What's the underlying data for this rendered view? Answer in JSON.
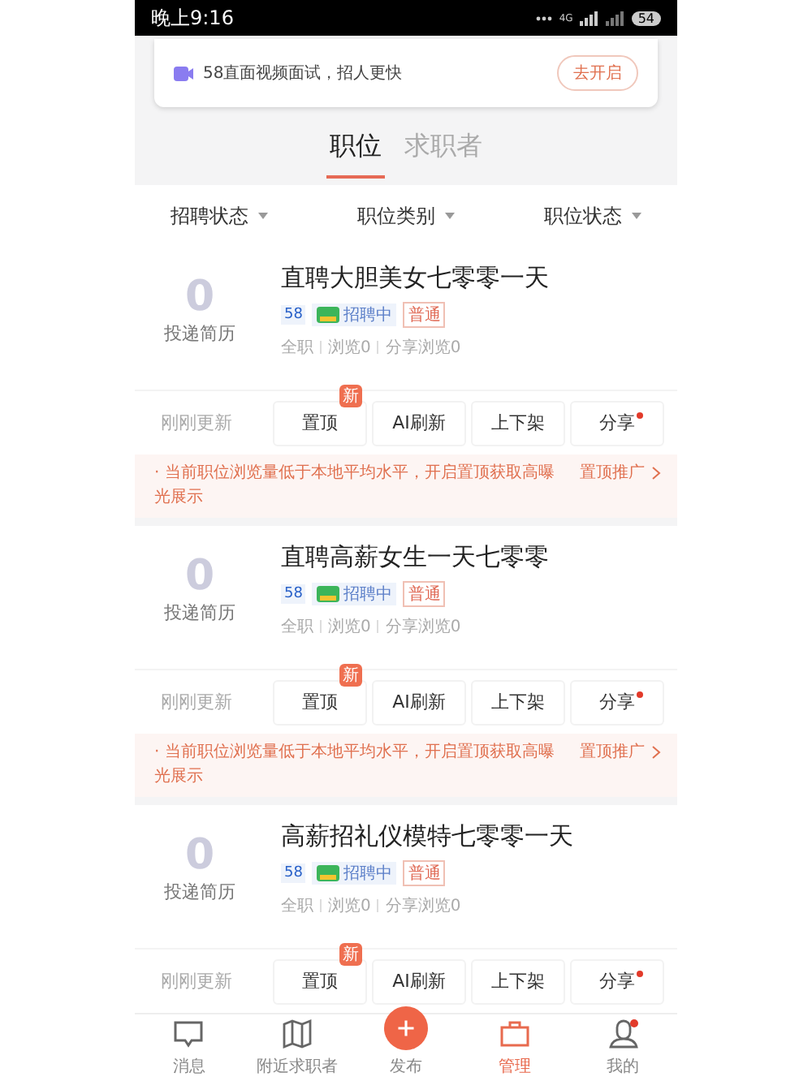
{
  "status_bar": {
    "time": "晚上9:16",
    "network": "4G",
    "battery": "54"
  },
  "banner": {
    "text": "58直面视频面试，招人更快",
    "button": "去开启"
  },
  "tabs": [
    {
      "label": "职位",
      "selected": true
    },
    {
      "label": "求职者",
      "selected": false
    }
  ],
  "filters": [
    "招聘状态",
    "职位类别",
    "职位状态"
  ],
  "jobs": [
    {
      "count": "0",
      "count_label": "投递简历",
      "title": "直聘大胆美女七零零一天",
      "brand": "58",
      "status": "招聘中",
      "tag": "普通",
      "meta": [
        "全职",
        "浏览0",
        "分享浏览0"
      ],
      "updated": "刚刚更新",
      "actions": [
        {
          "label": "置顶",
          "badge": "新",
          "dot": false
        },
        {
          "label": "AI刷新",
          "dot": false
        },
        {
          "label": "上下架",
          "dot": false
        },
        {
          "label": "分享",
          "dot": true
        }
      ],
      "tip": {
        "text": "· 当前职位浏览量低于本地平均水平，开启置顶获取高曝光展示",
        "link": "置顶推广"
      }
    },
    {
      "count": "0",
      "count_label": "投递简历",
      "title": "直聘高薪女生一天七零零",
      "brand": "58",
      "status": "招聘中",
      "tag": "普通",
      "meta": [
        "全职",
        "浏览0",
        "分享浏览0"
      ],
      "updated": "刚刚更新",
      "actions": [
        {
          "label": "置顶",
          "badge": "新",
          "dot": false
        },
        {
          "label": "AI刷新",
          "dot": false
        },
        {
          "label": "上下架",
          "dot": false
        },
        {
          "label": "分享",
          "dot": true
        }
      ],
      "tip": {
        "text": "· 当前职位浏览量低于本地平均水平，开启置顶获取高曝光展示",
        "link": "置顶推广"
      }
    },
    {
      "count": "0",
      "count_label": "投递简历",
      "title": "高薪招礼仪模特七零零一天",
      "brand": "58",
      "status": "招聘中",
      "tag": "普通",
      "meta": [
        "全职",
        "浏览0",
        "分享浏览0"
      ],
      "updated": "刚刚更新",
      "actions": [
        {
          "label": "置顶",
          "badge": "新",
          "dot": false
        },
        {
          "label": "AI刷新",
          "dot": false
        },
        {
          "label": "上下架",
          "dot": false
        },
        {
          "label": "分享",
          "dot": true
        }
      ]
    }
  ],
  "nav": [
    {
      "kind": "message",
      "label": "消息",
      "selected": false,
      "dot": false
    },
    {
      "kind": "map",
      "label": "附近求职者",
      "selected": false,
      "dot": false
    },
    {
      "kind": "plus",
      "label": "发布",
      "selected": false,
      "dot": false
    },
    {
      "kind": "briefcase",
      "label": "管理",
      "selected": true,
      "dot": false
    },
    {
      "kind": "user",
      "label": "我的",
      "selected": false,
      "dot": true
    }
  ]
}
